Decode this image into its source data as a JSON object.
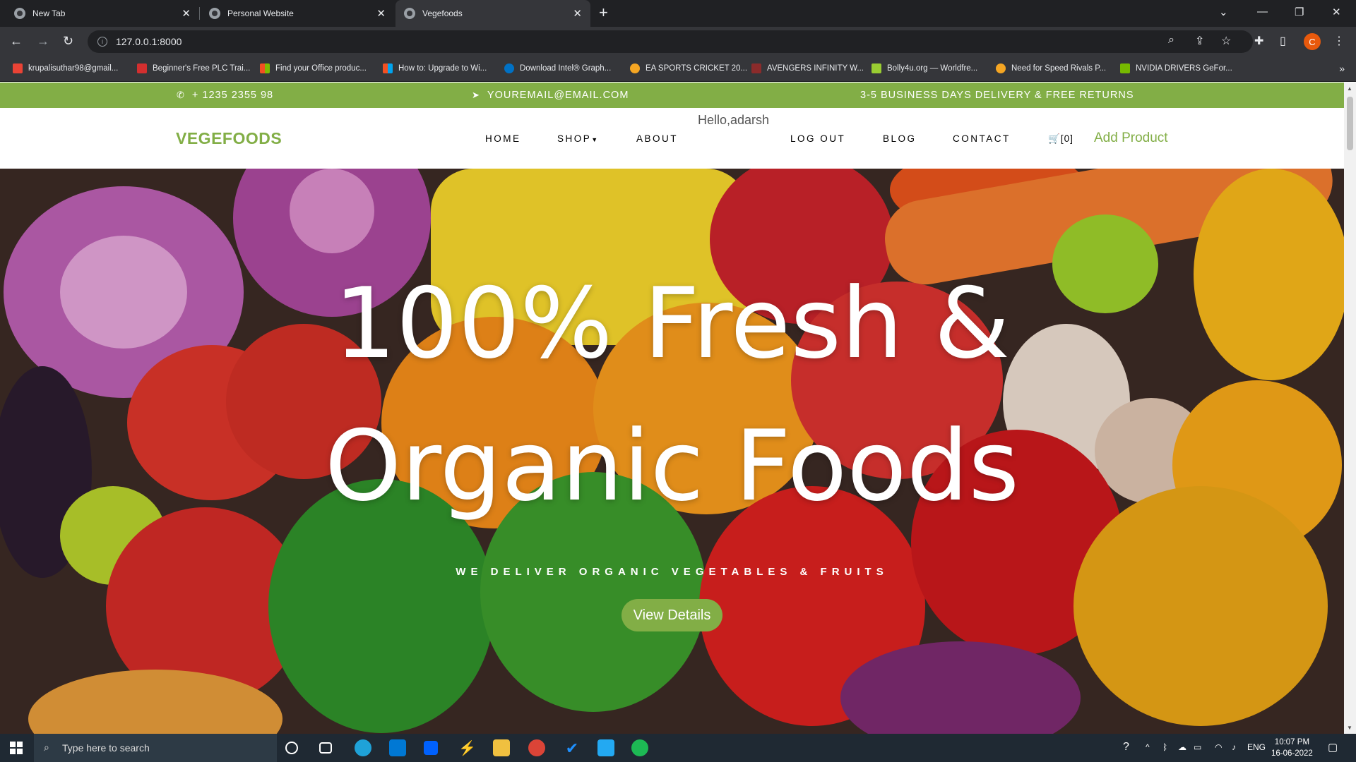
{
  "browser": {
    "tabs": [
      {
        "title": "New Tab"
      },
      {
        "title": "Personal Website"
      },
      {
        "title": "Vegefoods"
      }
    ],
    "url": "127.0.0.1:8000",
    "profile_initial": "C",
    "bookmarks": [
      {
        "label": "krupalisuthar98@gmail...",
        "icon": "gmail-icon",
        "color": "#ea4335"
      },
      {
        "label": "Beginner's Free PLC Trai...",
        "icon": "plc-icon",
        "color": "#d32f2f"
      },
      {
        "label": "Find your Office produc...",
        "icon": "microsoft-icon",
        "color": "#f25022"
      },
      {
        "label": "How to: Upgrade to Wi...",
        "icon": "microsoft-icon",
        "color": "#f25022"
      },
      {
        "label": "Download Intel® Graph...",
        "icon": "intel-icon",
        "color": "#0071c5"
      },
      {
        "label": "EA SPORTS CRICKET 20...",
        "icon": "game-icon",
        "color": "#f5a623"
      },
      {
        "label": "AVENGERS INFINITY W...",
        "icon": "hd-icon",
        "color": "#8b2b2b"
      },
      {
        "label": "Bolly4u.org — Worldfre...",
        "icon": "w-icon",
        "color": "#9acd32"
      },
      {
        "label": "Need for Speed Rivals P...",
        "icon": "game-icon",
        "color": "#f5a623"
      },
      {
        "label": "NVIDIA DRIVERS GeFor...",
        "icon": "nvidia-icon",
        "color": "#76b900"
      }
    ]
  },
  "site": {
    "accent": "#82ae46",
    "topbar": {
      "phone": "+ 1235 2355 98",
      "email": "YOUREMAIL@EMAIL.COM",
      "shipping": "3-5 BUSINESS DAYS DELIVERY & FREE RETURNS"
    },
    "brand": "VEGEFOODS",
    "greeting": "Hello,adarsh",
    "nav": {
      "home": "HOME",
      "shop": "SHOP",
      "about": "ABOUT",
      "logout": "LOG OUT",
      "blog": "BLOG",
      "contact": "CONTACT",
      "cart": "[0]",
      "add_product": "Add Product"
    },
    "hero": {
      "line1": "100% Fresh &",
      "line2": "Organic Foods",
      "subtitle": "WE DELIVER ORGANIC VEGETABLES & FRUITS",
      "button": "View Details"
    }
  },
  "taskbar": {
    "search_placeholder": "Type here to search",
    "language": "ENG",
    "time": "10:07 PM",
    "date": "16-06-2022"
  }
}
